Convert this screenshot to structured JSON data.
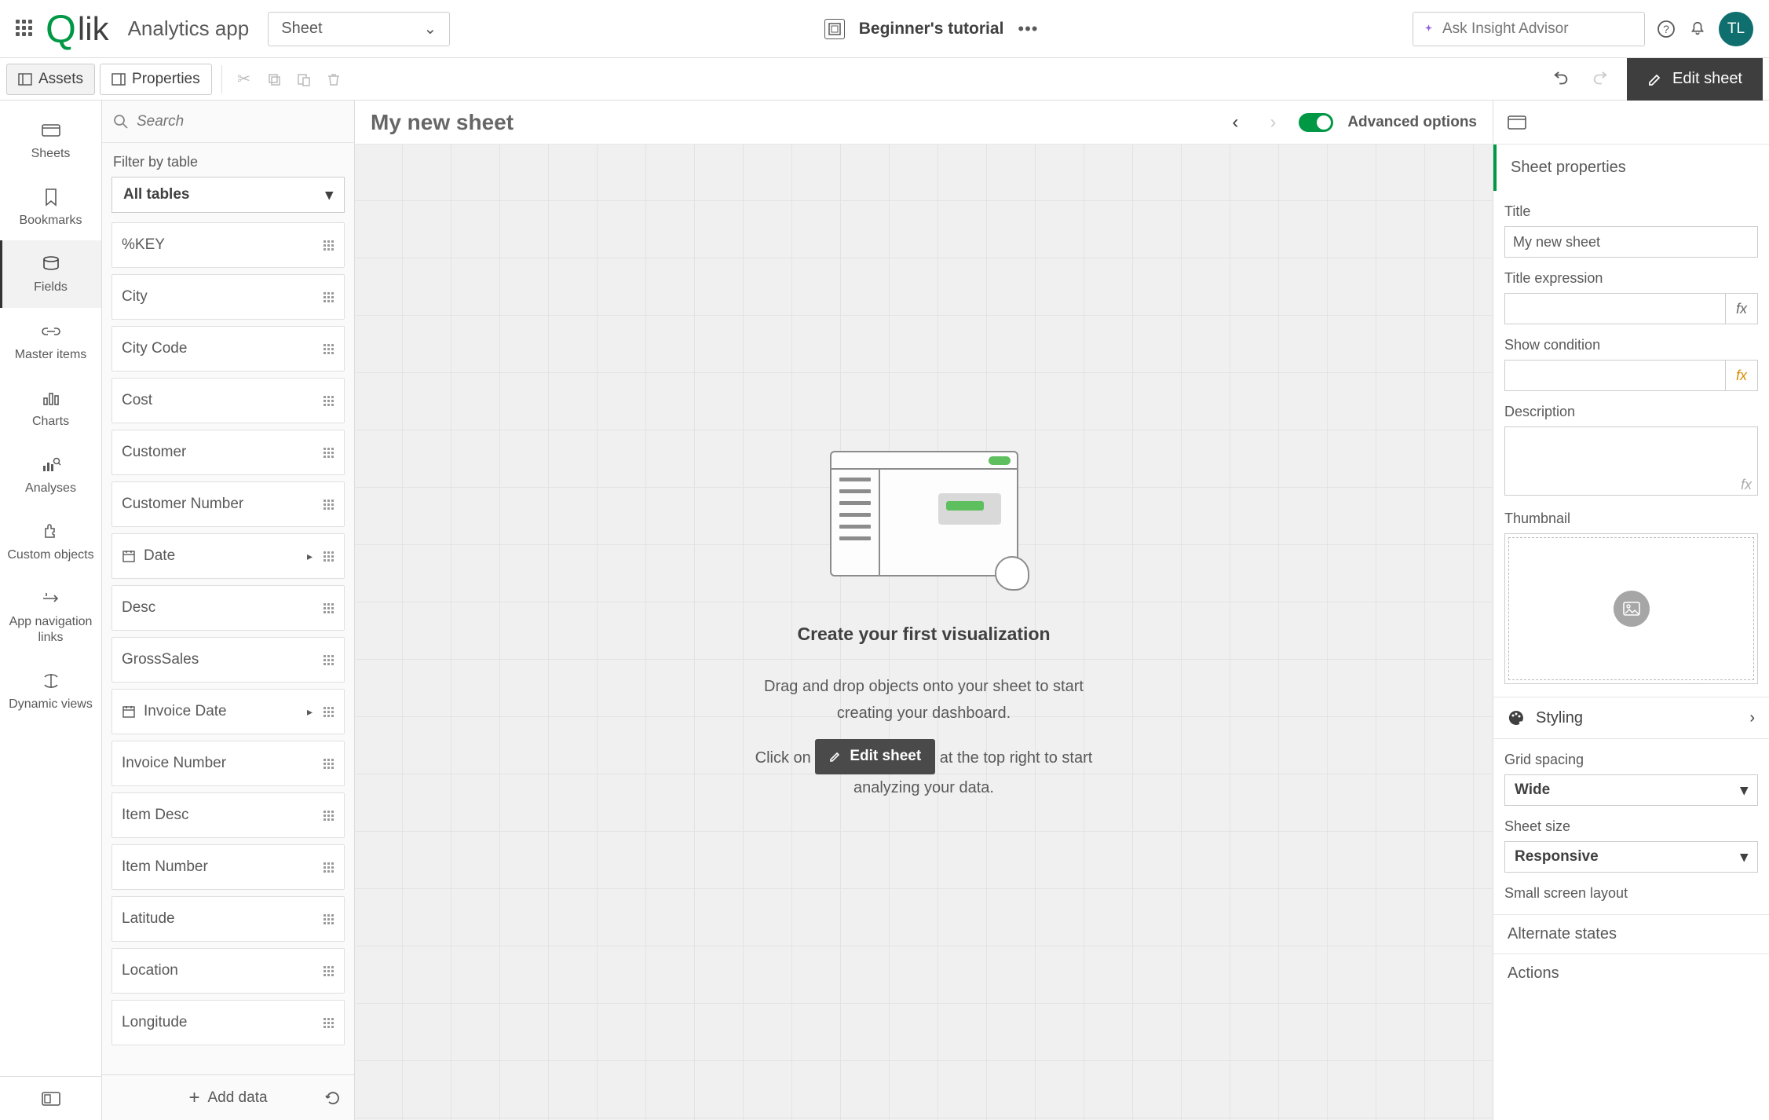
{
  "header": {
    "logo": "Qlik",
    "app_title": "Analytics app",
    "sheet_dropdown": "Sheet",
    "tutorial_label": "Beginner's tutorial",
    "insight_placeholder": "Ask Insight Advisor",
    "avatar_initials": "TL"
  },
  "secondbar": {
    "assets": "Assets",
    "properties": "Properties",
    "edit_sheet": "Edit sheet"
  },
  "rail": {
    "items": [
      {
        "label": "Sheets"
      },
      {
        "label": "Bookmarks"
      },
      {
        "label": "Fields"
      },
      {
        "label": "Master items"
      },
      {
        "label": "Charts"
      },
      {
        "label": "Analyses"
      },
      {
        "label": "Custom objects"
      },
      {
        "label": "App navigation links"
      },
      {
        "label": "Dynamic views"
      }
    ]
  },
  "fields_panel": {
    "search_placeholder": "Search",
    "filter_label": "Filter by table",
    "table_dropdown": "All tables",
    "add_data": "Add data",
    "fields": [
      {
        "name": "%KEY",
        "type": "text"
      },
      {
        "name": "City",
        "type": "text"
      },
      {
        "name": "City Code",
        "type": "text"
      },
      {
        "name": "Cost",
        "type": "text"
      },
      {
        "name": "Customer",
        "type": "text"
      },
      {
        "name": "Customer Number",
        "type": "text"
      },
      {
        "name": "Date",
        "type": "date"
      },
      {
        "name": "Desc",
        "type": "text"
      },
      {
        "name": "GrossSales",
        "type": "text"
      },
      {
        "name": "Invoice Date",
        "type": "date"
      },
      {
        "name": "Invoice Number",
        "type": "text"
      },
      {
        "name": "Item Desc",
        "type": "text"
      },
      {
        "name": "Item Number",
        "type": "text"
      },
      {
        "name": "Latitude",
        "type": "text"
      },
      {
        "name": "Location",
        "type": "text"
      },
      {
        "name": "Longitude",
        "type": "text"
      }
    ]
  },
  "canvas": {
    "sheet_title": "My new sheet",
    "advanced_label": "Advanced options",
    "empty_heading": "Create your first visualization",
    "empty_line1": "Drag and drop objects onto your sheet to start creating your dashboard.",
    "empty_line2a": "Click on",
    "empty_inline_btn": "Edit sheet",
    "empty_line2b": "at the top right to start analyzing your data."
  },
  "props": {
    "section_title": "Sheet properties",
    "title_label": "Title",
    "title_value": "My new sheet",
    "title_expr_label": "Title expression",
    "show_cond_label": "Show condition",
    "description_label": "Description",
    "thumbnail_label": "Thumbnail",
    "styling_label": "Styling",
    "grid_spacing_label": "Grid spacing",
    "grid_spacing_value": "Wide",
    "sheet_size_label": "Sheet size",
    "sheet_size_value": "Responsive",
    "small_screen_label": "Small screen layout",
    "alternate_states": "Alternate states",
    "actions": "Actions"
  }
}
